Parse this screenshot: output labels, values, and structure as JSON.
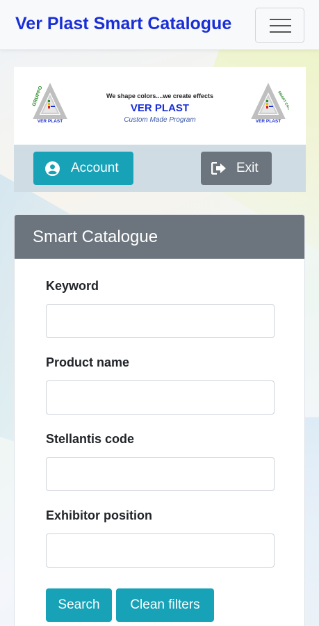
{
  "navbar": {
    "brand": "Ver Plast Smart Catalogue",
    "toggler_icon": "hamburger-menu-icon"
  },
  "logo_panel": {
    "tagline": "We shape colors....we create effects",
    "company": "VER PLAST",
    "subtitle": "Custom Made Program",
    "left_logo_text": "VER PLAST",
    "left_logo_arc": "GRUPPO",
    "right_logo_text": "VER PLAST",
    "right_logo_arc": "SMART CATALOGUE"
  },
  "actions": {
    "account_label": "Account",
    "account_icon": "user-circle-icon",
    "exit_label": "Exit",
    "exit_icon": "sign-out-icon"
  },
  "card": {
    "title": "Smart Catalogue",
    "fields": [
      {
        "label": "Keyword",
        "value": "",
        "placeholder": ""
      },
      {
        "label": "Product name",
        "value": "",
        "placeholder": ""
      },
      {
        "label": "Stellantis code",
        "value": "",
        "placeholder": ""
      },
      {
        "label": "Exhibitor position",
        "value": "",
        "placeholder": ""
      }
    ],
    "search_label": "Search",
    "clean_label": "Clean filters"
  },
  "colors": {
    "brand_blue": "#1a2fd6",
    "info": "#17a2b8",
    "secondary": "#6c757d",
    "action_bar": "#cfdce4"
  }
}
